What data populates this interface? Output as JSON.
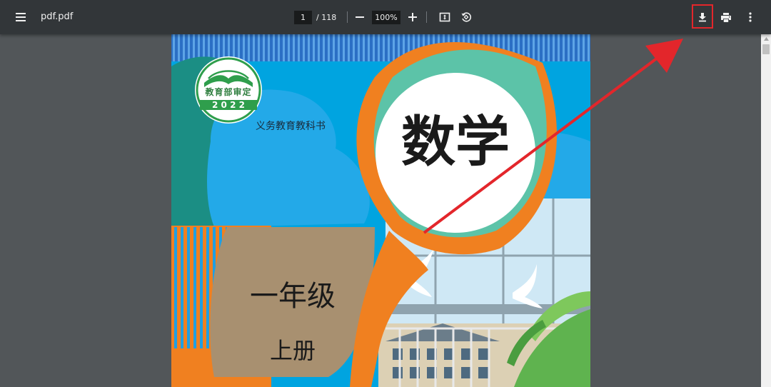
{
  "toolbar": {
    "menu_icon": "menu-icon",
    "title": "pdf.pdf",
    "page_current": "1",
    "page_total": "/ 118",
    "zoom_out_icon": "minus-icon",
    "zoom_value": "100%",
    "zoom_in_icon": "plus-icon",
    "fit_icon": "fit-page-icon",
    "rotate_icon": "rotate-icon",
    "download_icon": "download-icon",
    "print_icon": "print-icon",
    "more_icon": "more-vert-icon"
  },
  "cover": {
    "seal_text": "教育部审定",
    "seal_year": "2 0 2 2",
    "series": "义务教育教科书",
    "subject": "数学",
    "grade": "一年级",
    "volume": "上册"
  },
  "colors": {
    "toolbar_bg": "#323639",
    "viewer_bg": "#525659",
    "highlight": "#e3262b",
    "cover_blue": "#00a4e0",
    "cover_orange": "#f08020",
    "cover_teal": "#5cc3a8",
    "cover_tan": "#a89070"
  }
}
